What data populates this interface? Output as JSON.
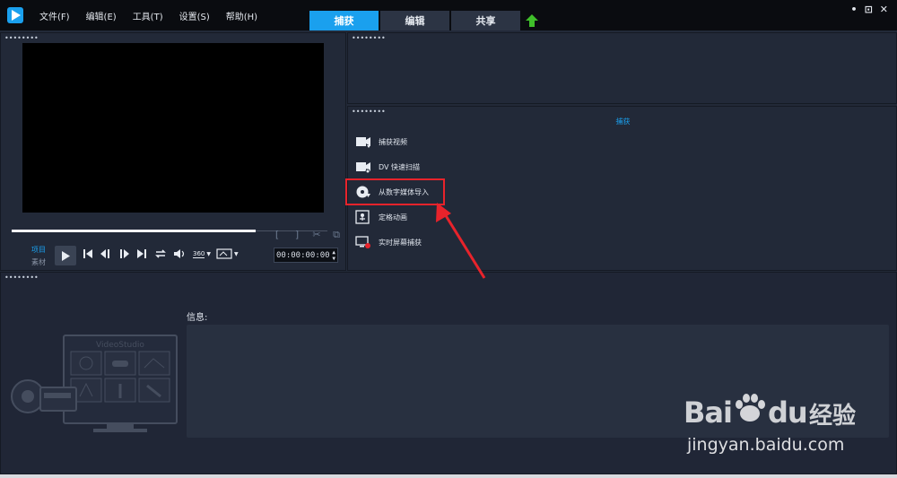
{
  "menu": {
    "items": [
      "文件(F)",
      "编辑(E)",
      "工具(T)",
      "设置(S)",
      "帮助(H)"
    ]
  },
  "mode_tabs": [
    {
      "label": "捕获",
      "active": true
    },
    {
      "label": "编辑",
      "active": false
    },
    {
      "label": "共享",
      "active": false
    }
  ],
  "window_controls": {
    "minimize": "•",
    "restore": "⊡",
    "close": "✕"
  },
  "player": {
    "mode_project": "项目",
    "mode_clip": "素材",
    "timecode": "00:00:00:00",
    "rotate_label": "360"
  },
  "capture": {
    "title": "捕获",
    "items": [
      {
        "label": "捕获视频",
        "icon": "video-capture-icon"
      },
      {
        "label": "DV 快速扫描",
        "icon": "dv-scan-icon"
      },
      {
        "label": "从数字媒体导入",
        "icon": "disc-import-icon"
      },
      {
        "label": "定格动画",
        "icon": "stop-motion-icon"
      },
      {
        "label": "实时屏幕捕获",
        "icon": "screen-capture-icon"
      }
    ],
    "highlighted_item": 2
  },
  "library": {
    "info_label": "信息:",
    "illustration_title": "VideoStudio"
  },
  "watermark": {
    "brand": "Bai",
    "brand2": "du",
    "cn": "经验",
    "url": "jingyan.baidu.com"
  },
  "colors": {
    "accent": "#1aa0ee",
    "highlight": "#e8232b",
    "upload_green": "#3fbf2a"
  }
}
